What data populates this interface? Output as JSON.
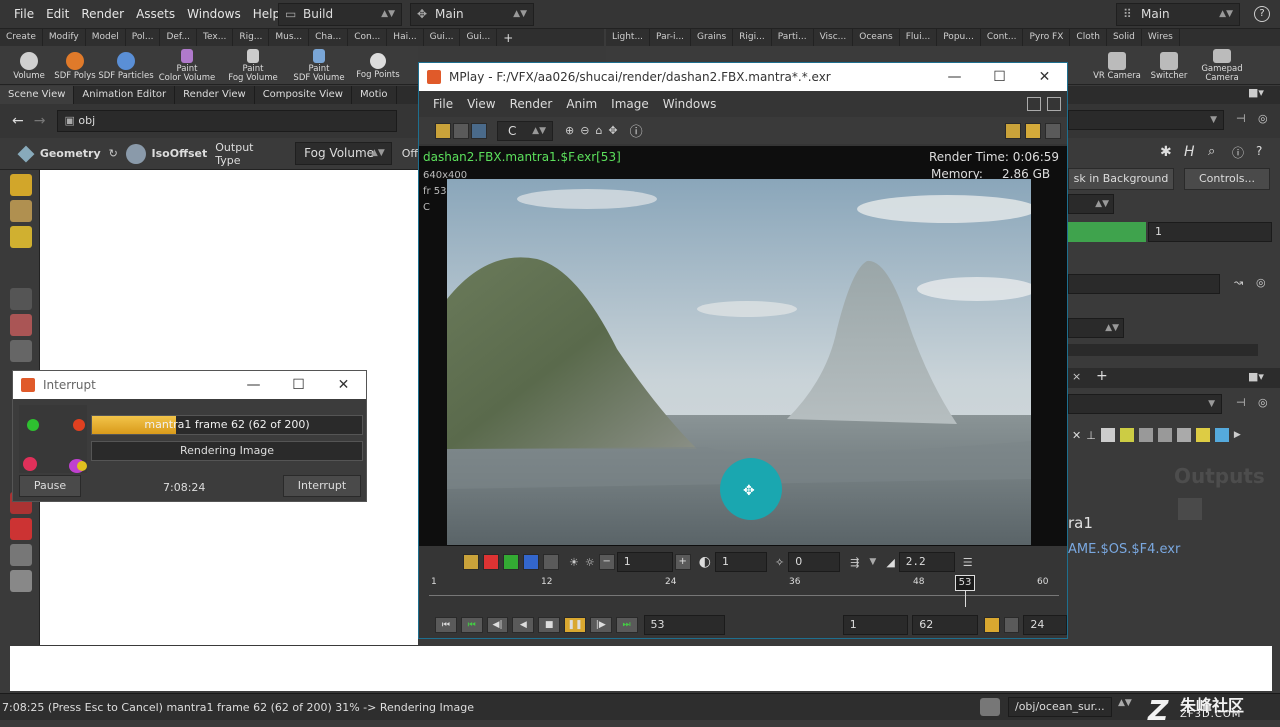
{
  "menubar": {
    "items": [
      "File",
      "Edit",
      "Render",
      "Assets",
      "Windows",
      "Help"
    ],
    "desktop": "Build",
    "context": "Main",
    "right_context": "Main"
  },
  "shelf_left": {
    "tabs": [
      "Create",
      "Modify",
      "Model",
      "Pol...",
      "Def...",
      "Tex...",
      "Rig...",
      "Mus...",
      "Cha...",
      "Con...",
      "Hai...",
      "Gui...",
      "Gui..."
    ],
    "tools": [
      {
        "label1": "Volume",
        "label2": "",
        "icon": "volume-icon",
        "color": "#d0d0d0"
      },
      {
        "label1": "SDF Polys",
        "label2": "",
        "icon": "sdf-polys-icon",
        "color": "#e07a2a"
      },
      {
        "label1": "SDF Particles",
        "label2": "",
        "icon": "sdf-particles-icon",
        "color": "#5a8fd6"
      },
      {
        "label1": "Paint",
        "label2": "Color Volume",
        "icon": "paint-color-volume-icon",
        "color": "#b07acc"
      },
      {
        "label1": "Paint",
        "label2": "Fog Volume",
        "icon": "paint-fog-volume-icon",
        "color": "#cccccc"
      },
      {
        "label1": "Paint",
        "label2": "SDF Volume",
        "icon": "paint-sdf-volume-icon",
        "color": "#7aa6d6"
      },
      {
        "label1": "Fog Points",
        "label2": "",
        "icon": "fog-points-icon",
        "color": "#dddddd"
      }
    ]
  },
  "shelf_right": {
    "tabs": [
      "Light...",
      "Par-i...",
      "Grains",
      "Rigi...",
      "Parti...",
      "Visc...",
      "Oceans",
      "Flui...",
      "Popu...",
      "Cont...",
      "Pyro FX",
      "Cloth",
      "Solid",
      "Wires"
    ],
    "tools": [
      {
        "label1": "VR Camera",
        "icon": "vr-camera-icon"
      },
      {
        "label1": "Switcher",
        "icon": "switcher-icon"
      },
      {
        "label1": "Gamepad",
        "label2": "Camera",
        "icon": "gamepad-camera-icon"
      }
    ]
  },
  "pane_tabs": [
    "Scene View",
    "Animation Editor",
    "Render View",
    "Composite View",
    "Motio"
  ],
  "path": "obj",
  "geo_bar": {
    "context": "Geometry",
    "node": "IsoOffset",
    "output_label": "Output Type",
    "output_value": "Fog Volume",
    "trailing": "Off"
  },
  "right_panel": {
    "bg_button": "sk in Background",
    "controls_button": "Controls...",
    "value_one": "1",
    "outputs_title": "Outputs",
    "ra_text": "ra1",
    "expr_text": "AME.$OS.$F4.exr"
  },
  "mplay": {
    "title": "MPlay - F:/VFX/aa026/shucai/render/dashan2.FBX.mantra*.*.exr",
    "menu": [
      "File",
      "View",
      "Render",
      "Anim",
      "Image",
      "Windows"
    ],
    "channel": "C",
    "image_name": "dashan2.FBX.mantra1.$F.exr[53]",
    "resolution": "640x400",
    "frame_info": "fr 53",
    "channel_info": "C",
    "render_time": "Render Time: 0:06:59",
    "memory": "Memory:     2.86 GB",
    "field_a": "1",
    "field_b": "1",
    "field_c": "0",
    "gamma": "2.2",
    "ticks": [
      "1",
      "12",
      "24",
      "36",
      "48",
      "60"
    ],
    "current_frame_marker": "53",
    "current_frame": "53",
    "range_start": "1",
    "range_end": "62",
    "fps": "24"
  },
  "interrupt": {
    "title": "Interrupt",
    "progress_text": "mantra1 frame 62 (62 of 200)",
    "progress": 0.31,
    "status": "Rendering Image",
    "pause": "Pause",
    "time": "7:08:24",
    "interrupt_button": "Interrupt"
  },
  "status_bar": {
    "message": "7:08:25 (Press Esc to Cancel) mantra1 frame 62 (62 of 200) 31% -> Rendering Image",
    "path": "/obj/ocean_sur...",
    "watermark": "朱峰社区",
    "watermark_url": "ZF3D.COM"
  }
}
